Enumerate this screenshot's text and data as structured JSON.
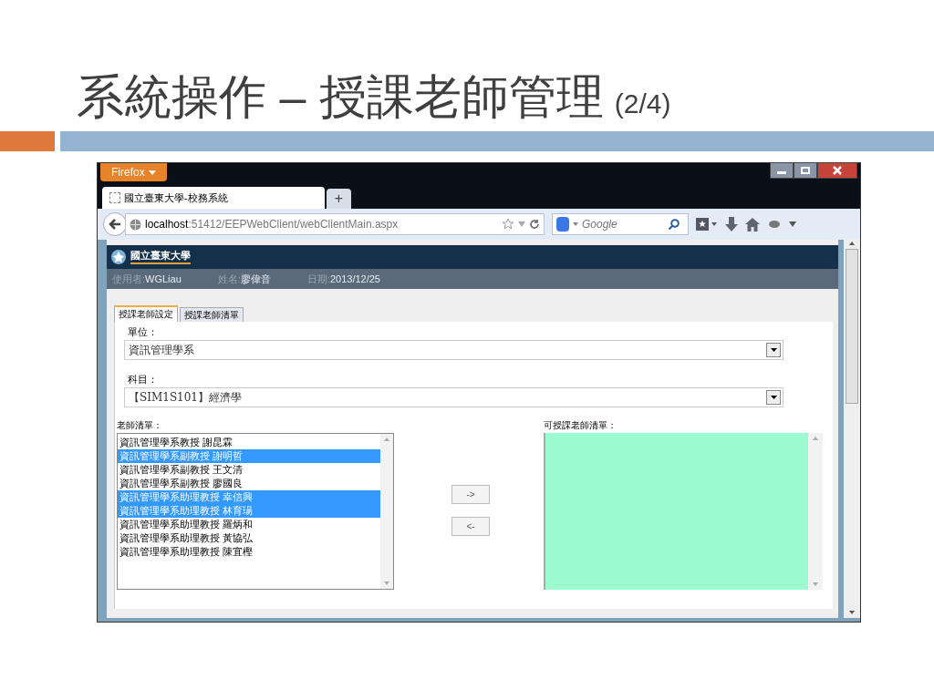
{
  "slide": {
    "title": "系統操作 – 授課老師管理",
    "title_suffix": "(2/4)"
  },
  "browser": {
    "menu_button": "Firefox",
    "tabs": [
      {
        "label": "國立臺東大學-校務系統",
        "selected": true
      }
    ],
    "new_tab": "+",
    "url": {
      "host": "localhost",
      "path": ":51412/EEPWebClient/webClientMain.aspx"
    },
    "search": {
      "placeholder": "Google"
    }
  },
  "page": {
    "logo_text": "國立臺東大學",
    "user_bar": [
      {
        "label": "使用者:",
        "value": "WGLiau"
      },
      {
        "label": "姓名:",
        "value": "廖偉音"
      },
      {
        "label": "日期:",
        "value": "2013/12/25"
      }
    ],
    "tabs": [
      {
        "label": "授課老師設定",
        "selected": true
      },
      {
        "label": "授課老師清單",
        "selected": false
      }
    ],
    "fields": [
      {
        "label": "單位：",
        "value": "資訊管理學系"
      },
      {
        "label": "科目：",
        "value": "【SIM1S101】經濟學"
      }
    ],
    "teacher_list": {
      "label": "老師清單：",
      "items": [
        {
          "text": "資訊管理學系教授 謝昆霖",
          "selected": false
        },
        {
          "text": "資訊管理學系副教授 謝明哲",
          "selected": true
        },
        {
          "text": "資訊管理學系副教授 王文清",
          "selected": false
        },
        {
          "text": "資訊管理學系副教授 廖國良",
          "selected": false
        },
        {
          "text": "資訊管理學系助理教授 幸信興",
          "selected": true
        },
        {
          "text": "資訊管理學系助理教授 林育瑒",
          "selected": true
        },
        {
          "text": "資訊管理學系助理教授 羅炳和",
          "selected": false
        },
        {
          "text": "資訊管理學系助理教授 黃協弘",
          "selected": false
        },
        {
          "text": "資訊管理學系助理教授 陳宜樫",
          "selected": false
        }
      ]
    },
    "move_buttons": [
      "->",
      "<-"
    ],
    "available_list": {
      "label": "可授課老師清單："
    }
  }
}
